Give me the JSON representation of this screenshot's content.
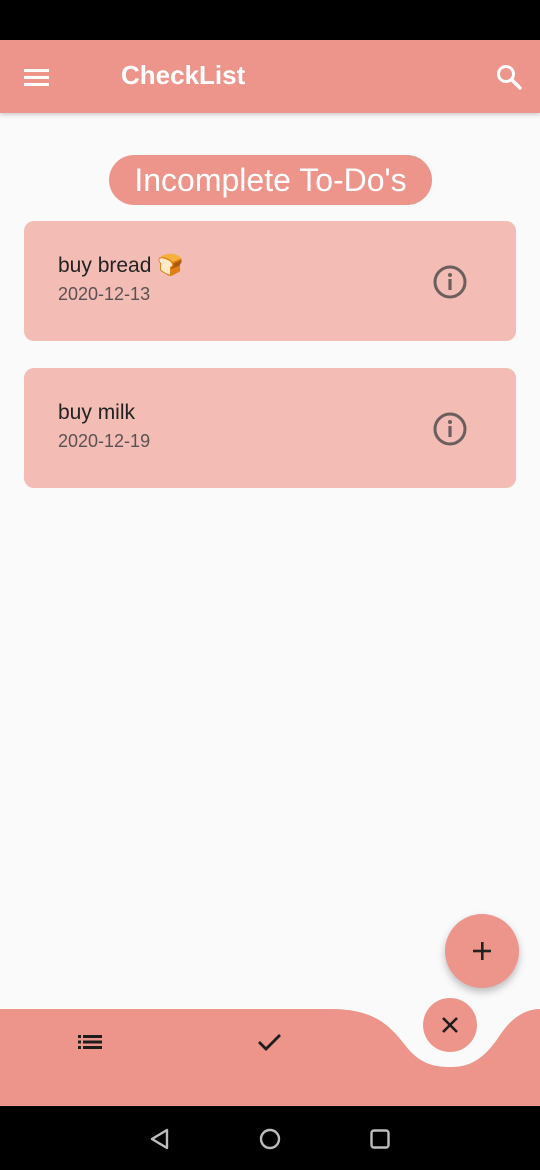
{
  "app": {
    "title": "CheckList"
  },
  "section": {
    "title": "Incomplete To-Do's"
  },
  "todos": [
    {
      "title": "buy bread 🍞",
      "date": "2020-12-13"
    },
    {
      "title": "buy milk",
      "date": "2020-12-19"
    }
  ],
  "icons": {
    "menu": "menu-icon",
    "search": "search-icon",
    "info": "info-icon",
    "add": "plus-icon",
    "close": "close-icon",
    "list": "list-icon",
    "check": "check-icon",
    "back": "back-triangle-icon",
    "home": "home-circle-icon",
    "recents": "recents-square-icon"
  },
  "colors": {
    "primary": "#ed958b",
    "card": "#f3bcb5",
    "background": "#fafafa",
    "on_primary": "#ffffff"
  }
}
